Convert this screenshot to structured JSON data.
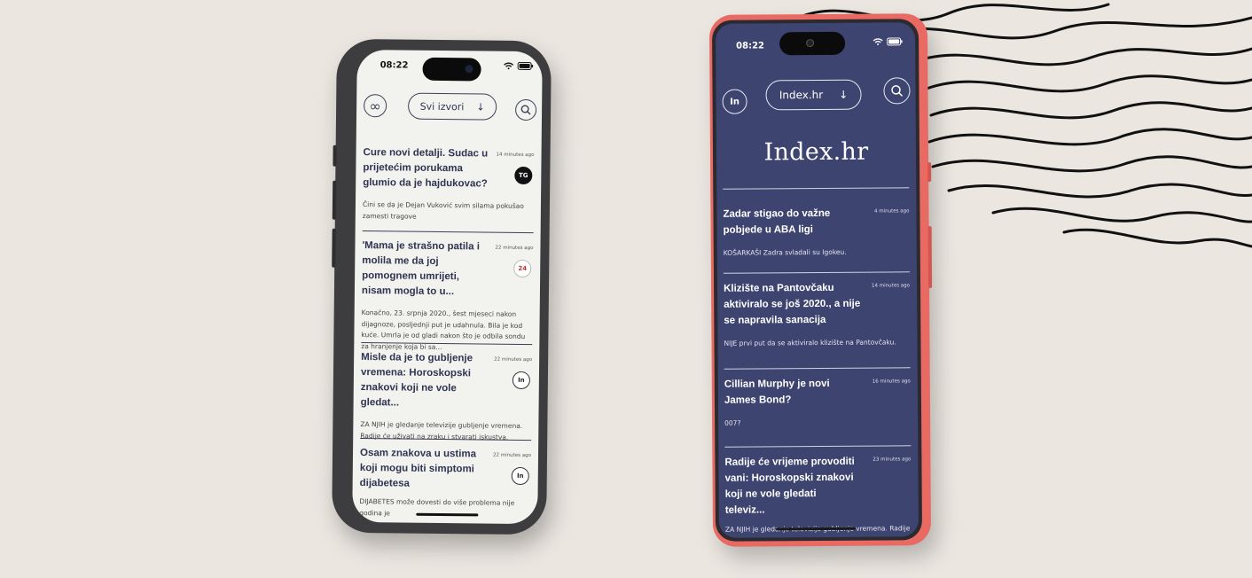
{
  "phone_light": {
    "status_time": "08:22",
    "status_icons": "wifi battery",
    "logo_icon": "infinity-icon",
    "source_selector": "Svi izvori",
    "articles": [
      {
        "title": "Cure novi detalji. Sudac u prijetećim porukama glumio da je hajdukovac?",
        "time": "14 minutes ago",
        "source_logo": "TG",
        "excerpt": "Čini se da je Dejan Vuković svim silama pokušao zamesti tragove"
      },
      {
        "title": "'Mama je strašno patila i molila me da joj pomognem umrijeti, nisam mogla to u...",
        "time": "22 minutes ago",
        "source_logo": "24",
        "excerpt": "Konačno, 23. srpnja 2020., šest mjeseci nakon dijagnoze, posljednji put je udahnula. Bila je kod kuće. Umrla je od gladi nakon što je odbila sondu za hranjenje koja bi sa..."
      },
      {
        "title": "Misle da je to gubljenje vremena: Horoskopski znakovi koji ne vole gledat...",
        "time": "22 minutes ago",
        "source_logo": "In",
        "excerpt": "ZA NJIH je gledanje televizije gubljenje vremena. Radije će uživati na zraku i stvarati iskustva."
      },
      {
        "title": "Osam znakova u ustima koji mogu biti simptomi dijabetesa",
        "time": "22 minutes ago",
        "source_logo": "In",
        "excerpt": "DIJABETES može dovesti do više problema nije godina je"
      }
    ]
  },
  "phone_dark": {
    "status_time": "08:22",
    "status_icons": "wifi battery",
    "logo_label": "In",
    "source_selector": "Index.hr",
    "brand": "Index.hr",
    "articles": [
      {
        "title": "Zadar stigao do važne pobjede u ABA ligi",
        "time": "4 minutes ago",
        "excerpt": "KOŠARKAŠI Zadra svladali su Igokeu."
      },
      {
        "title": "Klizište na Pantovčaku aktiviralo se još 2020., a nije se napravila sanacija",
        "time": "14 minutes ago",
        "excerpt": "NIJE prvi put da se aktiviralo klizište na Pantovčaku."
      },
      {
        "title": "Cillian Murphy je novi James Bond?",
        "time": "16 minutes ago",
        "excerpt": "007?"
      },
      {
        "title": "Radije će vrijeme provoditi vani: Horoskopski znakovi koji ne vole gledati televiz...",
        "time": "23 minutes ago",
        "excerpt": "ZA NJIH je gledanje televizije gubljenje vremena. Radije će uživati na zraku i stvarati iskustva."
      }
    ]
  }
}
